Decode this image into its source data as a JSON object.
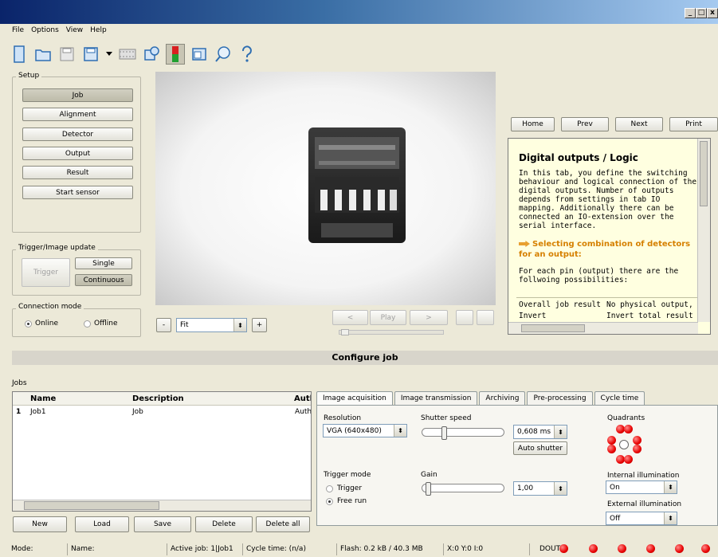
{
  "window": {
    "controls": [
      "_",
      "□",
      "x"
    ]
  },
  "menu": [
    "File",
    "Options",
    "View",
    "Help"
  ],
  "toolbar": [
    "new-icon",
    "open-icon",
    "save-icon",
    "save-as-icon",
    "dropdown-arrow-icon",
    "filmstrip-icon",
    "camera-icon",
    "sensor-icon",
    "window-icon",
    "search-icon",
    "help-icon"
  ],
  "setup": {
    "legend": "Setup",
    "buttons": [
      "Job",
      "Alignment",
      "Detector",
      "Output",
      "Result",
      "Start sensor"
    ]
  },
  "trigger_group": {
    "legend": "Trigger/Image update",
    "trigger": "Trigger",
    "single": "Single",
    "continuous": "Continuous"
  },
  "connection": {
    "legend": "Connection mode",
    "online": "Online",
    "offline": "Offline"
  },
  "image_controls": {
    "minus": "-",
    "zoom": "Fit",
    "plus": "+",
    "prev": "<",
    "play": "Play",
    "next": ">"
  },
  "help_nav": {
    "home": "Home",
    "prev": "Prev",
    "next": "Next",
    "print": "Print"
  },
  "help": {
    "title": "Digital outputs / Logic",
    "text": "In this tab, you define the switching behaviour and logical connection of the digital outputs. Number of outputs depends from settings in tab IO mapping. Additionally there can be connected an IO-extension over the serial interface.",
    "subtitle": "Selecting combination of detectors for an output:",
    "text2": "For each pin (output) there are the follwoing possibilities:",
    "row1_a": "Overall job result",
    "row1_b": "No physical output, effects",
    "row2_a": "Invert",
    "row2_b": "Invert total result for this"
  },
  "section_title": "Configure job",
  "jobs": {
    "label": "Jobs",
    "columns": [
      "Name",
      "Description",
      "Auth"
    ],
    "rows": [
      {
        "num": "1",
        "name": "Job1",
        "desc": "Job",
        "auth": "Authc"
      }
    ],
    "buttons": [
      "New",
      "Load",
      "Save",
      "Delete",
      "Delete all"
    ]
  },
  "tabs": [
    "Image acquisition",
    "Image transmission",
    "Archiving",
    "Pre-processing",
    "Cycle time"
  ],
  "acq": {
    "resolution_label": "Resolution",
    "resolution": "VGA (640x480)",
    "shutter_label": "Shutter speed",
    "shutter_value": "0,608 ms",
    "auto_shutter": "Auto shutter",
    "trigger_mode_label": "Trigger mode",
    "trigger_opt": "Trigger",
    "freerun_opt": "Free run",
    "gain_label": "Gain",
    "gain_value": "1,00",
    "quadrants_label": "Quadrants",
    "internal_label": "Internal illumination",
    "internal_value": "On",
    "external_label": "External illumination",
    "external_value": "Off"
  },
  "status": {
    "mode": "Mode:",
    "name": "Name:",
    "active_job": "Active job:  1|Job1",
    "cycle": "Cycle time:  (n/a)",
    "flash": "Flash:  0.2 kB / 40.3 MB",
    "coords": "X:0 Y:0 I:0",
    "dout": "DOUT"
  },
  "colors": {
    "led": "#e80000",
    "help_bg": "#ffffe0",
    "accent": "#0a246a"
  }
}
